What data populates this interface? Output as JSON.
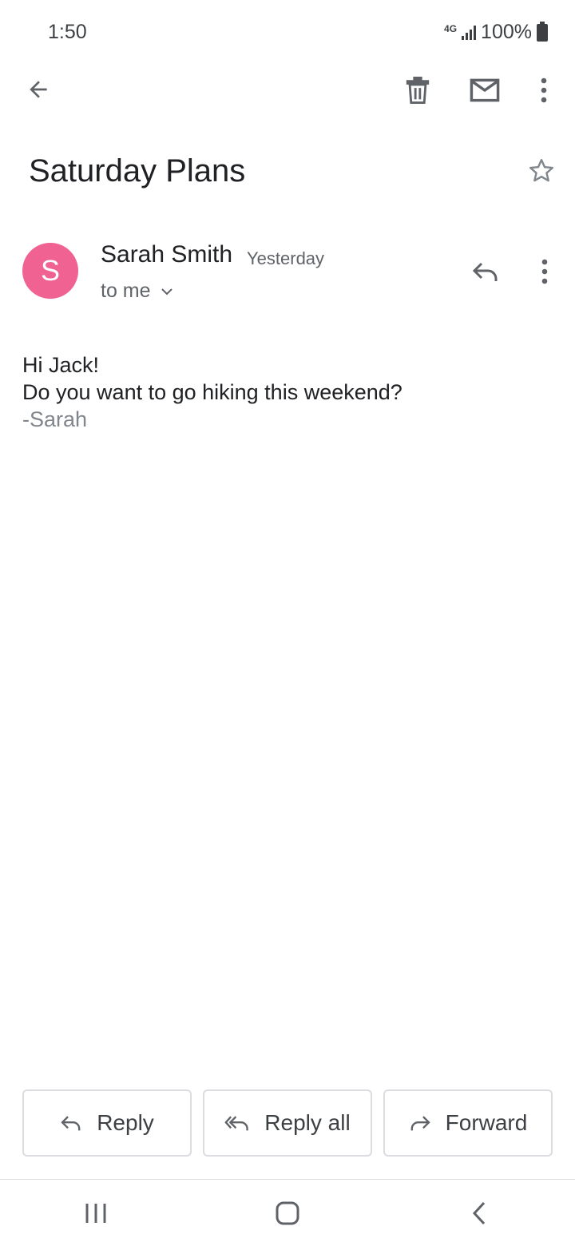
{
  "status_bar": {
    "time": "1:50",
    "network": "4G",
    "battery_pct": "100%"
  },
  "toolbar": {
    "back_icon": "arrow-back-icon",
    "delete_icon": "trash-icon",
    "mark_unread_icon": "mail-icon",
    "more_icon": "more-vert-icon"
  },
  "email": {
    "subject": "Saturday Plans",
    "sender_initial": "S",
    "sender_name": "Sarah Smith",
    "time": "Yesterday",
    "recipient": "to me",
    "body_line1": "Hi Jack!",
    "body_line2": "Do you want to go hiking this weekend?",
    "signature": "-Sarah",
    "avatar_color": "#f06292"
  },
  "actions": {
    "reply": "Reply",
    "reply_all": "Reply all",
    "forward": "Forward"
  }
}
